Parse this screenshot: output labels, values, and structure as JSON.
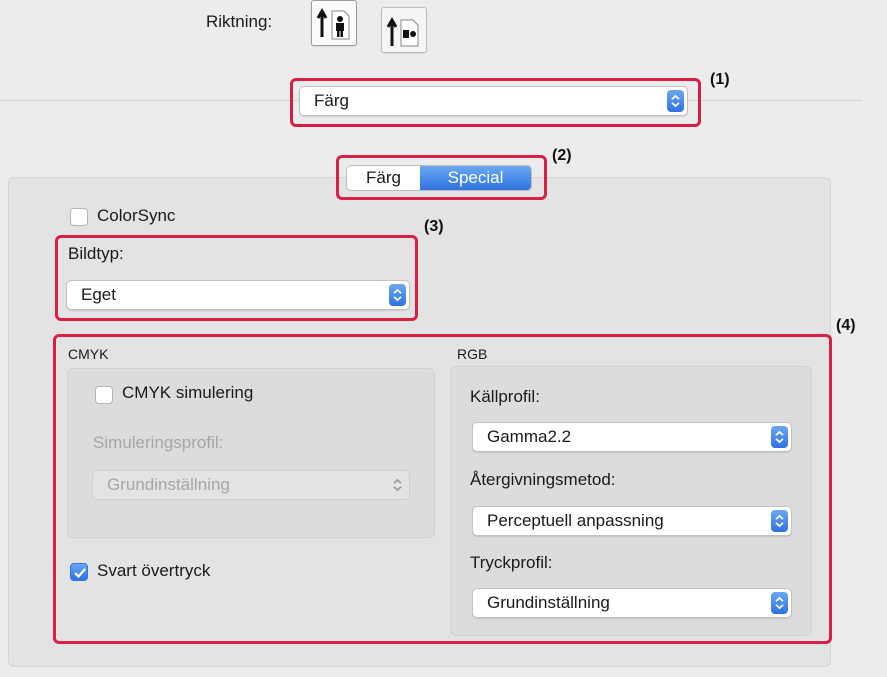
{
  "orientation": {
    "label": "Riktning:",
    "options": [
      {
        "name": "portrait",
        "icon": "portrait-orientation-icon",
        "selected": true
      },
      {
        "name": "landscape",
        "icon": "landscape-orientation-icon",
        "selected": false
      }
    ]
  },
  "panel_select": {
    "value": "Färg"
  },
  "tabs": [
    {
      "label": "Färg",
      "selected": false
    },
    {
      "label": "Special",
      "selected": true
    }
  ],
  "colorsync": {
    "label": "ColorSync",
    "checked": false
  },
  "image_type": {
    "label": "Bildtyp:",
    "value": "Eget"
  },
  "cmyk": {
    "heading": "CMYK",
    "simulation": {
      "label": "CMYK simulering",
      "checked": false
    },
    "profile_label": "Simuleringsprofil:",
    "profile_value": "Grundinställning"
  },
  "black_overprint": {
    "label": "Svart övertryck",
    "checked": true
  },
  "rgb": {
    "heading": "RGB",
    "source_profile": {
      "label": "Källprofil:",
      "value": "Gamma2.2"
    },
    "rendering": {
      "label": "Återgivningsmetod:",
      "value": "Perceptuell anpassning"
    },
    "print_profile": {
      "label": "Tryckprofil:",
      "value": "Grundinställning"
    }
  },
  "callouts": [
    "(1)",
    "(2)",
    "(3)",
    "(4)"
  ],
  "colors": {
    "accent": "#2f72e0",
    "highlight": "#d81f45",
    "background": "#ececec"
  }
}
